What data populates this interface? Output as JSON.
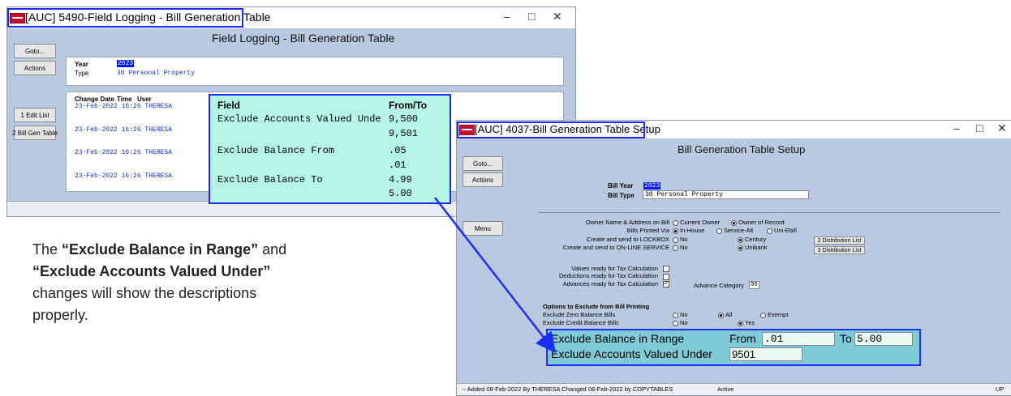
{
  "window1": {
    "title": "[AUC] 5490-Field Logging - Bill Generation Table",
    "heading": "Field Logging - Bill Generation Table",
    "controls": [
      "–",
      "□",
      "✕"
    ],
    "buttons": {
      "goto": "Goto...",
      "actions": "Actions",
      "edit_list": "1 Edit List",
      "bill_gen_table": "2 Bill Gen Table"
    },
    "year_label": "Year",
    "year_value": "2023",
    "type_label": "Type",
    "type_value": "30 Personal Property",
    "log_headers": {
      "change_date": "Change Date",
      "time": "Time",
      "user": "User"
    },
    "log_rows": [
      "23-Feb-2022 16:26 THERESA",
      "23-Feb-2022 16:26 THERESA",
      "23-Feb-2022 16:26 THERESA",
      "23-Feb-2022 16:26 THERESA"
    ]
  },
  "overlay": {
    "headers": {
      "field": "Field",
      "from_to": "From/To"
    },
    "rows": [
      {
        "field": "Exclude Accounts Valued Unde",
        "from": "9,500",
        "to": "9,501"
      },
      {
        "field": "Exclude Balance From",
        "from": ".05",
        "to": ".01"
      },
      {
        "field": "Exclude Balance To",
        "from": "4.99",
        "to": "5.00"
      }
    ]
  },
  "caption": {
    "text_before": "The ",
    "bold1": "“Exclude Balance in Range”",
    "text_mid": " and ",
    "bold2": "“Exclude Accounts Valued Under”",
    "text_after": " changes will show the descriptions properly."
  },
  "window2": {
    "title": "[AUC] 4037-Bill Generation Table Setup",
    "heading": "Bill Generation Table Setup",
    "controls": [
      "–",
      "□",
      "✕"
    ],
    "buttons": {
      "goto": "Goto...",
      "actions": "Actions",
      "menu": "Menu",
      "dist1": "2 Distribution List",
      "dist2": "3 Distribution List"
    },
    "bill_year_label": "Bill Year",
    "bill_year_value": "2023",
    "bill_type_label": "Bill Type",
    "bill_type_value": "30 Personal Property",
    "rows": {
      "owner_label": "Owner Name & Address on Bill",
      "owner_opt1": "Current Owner",
      "owner_opt2": "Owner of Record",
      "printed_label": "Bills Printed Via",
      "printed_opt1": "In-House",
      "printed_opt2": "Service-Alt",
      "printed_opt3": "Uni-Ebill",
      "lockbox_label": "Create and send to LOCKBOX",
      "lockbox_opt1": "No",
      "lockbox_opt2": "Century",
      "online_label": "Create and send to ON-LINE SERVICE",
      "online_opt1": "No",
      "online_opt2": "Unibank",
      "values_ready": "Values ready for Tax Calculation",
      "deductions_ready": "Deductions ready for Tax Calculation",
      "advances_ready": "Advances ready for Tax Calculation",
      "advance_category_label": "Advance Category",
      "advance_category_value": "90",
      "options_heading": "Options to Exclude from Bill Printing",
      "zero_label": "Exclude Zero Balance Bills",
      "zero_opt1": "No",
      "zero_opt2": "All",
      "zero_opt3": "Exempt",
      "credit_label": "Exclude Credit Balance Bills",
      "credit_opt1": "No",
      "credit_opt2": "Yes"
    },
    "range_label": "Exclude Balance in Range",
    "from_label": "From",
    "from_value": ".01",
    "to_label": "To",
    "to_value": "5.00",
    "valued_under_label": "Exclude Accounts Valued Under",
    "valued_under_value": "9501",
    "status_text": "-- Added 08-Feb-2022 By THERESA Changed 08-Feb-2022 by COPYTABLES",
    "status_state": "Active",
    "status_right": "UP"
  }
}
